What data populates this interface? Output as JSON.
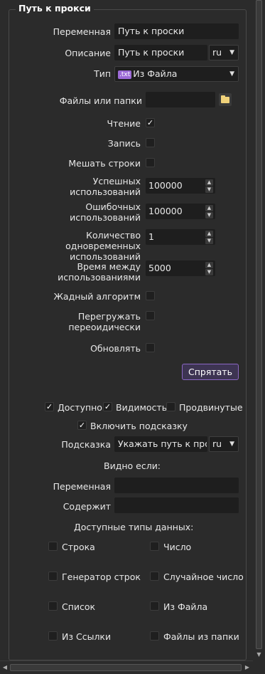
{
  "group_title": "Путь к прокси",
  "fields": {
    "variable_label": "Переменная",
    "variable_value": "Путь к проски",
    "description_label": "Описание",
    "description_value": "Путь к проски",
    "description_lang": "ru",
    "type_label": "Тип",
    "type_badge": ".txt",
    "type_value": "Из Файла",
    "files_label": "Файлы или папки",
    "files_value": ""
  },
  "options": {
    "read_label": "Чтение",
    "read_checked": true,
    "write_label": "Запись",
    "write_checked": false,
    "shuffle_label": "Мешать строки",
    "shuffle_checked": false,
    "success_label": "Успешных использований",
    "success_value": "100000",
    "error_label": "Ошибочных использований",
    "error_value": "100000",
    "concurrent_label": "Количество одновременных использований",
    "concurrent_value": "1",
    "interval_label": "Время между использованиями",
    "interval_value": "5000",
    "greedy_label": "Жадный алгоритм",
    "greedy_checked": false,
    "reload_label": "Перегружать переоидически",
    "reload_checked": false,
    "update_label": "Обновлять",
    "update_checked": false
  },
  "hide_button": "Спрятать",
  "visibility": {
    "available_label": "Доступно",
    "available_checked": true,
    "visible_label": "Видимость",
    "visible_checked": true,
    "advanced_label": "Продвинутые",
    "advanced_checked": false,
    "hint_toggle_label": "Включить подсказку",
    "hint_toggle_checked": true,
    "hint_label": "Подсказка",
    "hint_value": "Укажать путь к прокси",
    "hint_lang": "ru"
  },
  "visible_if": {
    "title": "Видно если:",
    "variable_label": "Переменная",
    "variable_value": "",
    "contains_label": "Содержит",
    "contains_value": ""
  },
  "data_types": {
    "title": "Доступные типы данных:",
    "items": [
      {
        "label": "Строка",
        "checked": false
      },
      {
        "label": "Число",
        "checked": false
      },
      {
        "label": "Генератор строк",
        "checked": false
      },
      {
        "label": "Случайное число",
        "checked": false
      },
      {
        "label": "Список",
        "checked": false
      },
      {
        "label": "Из Файла",
        "checked": false
      },
      {
        "label": "Из Ссылки",
        "checked": false
      },
      {
        "label": "Файлы из папки",
        "checked": false
      }
    ]
  },
  "icons": {
    "check": "✓",
    "dropdown": "▼",
    "up": "▲",
    "down": "▼",
    "folder": "folder-icon"
  }
}
